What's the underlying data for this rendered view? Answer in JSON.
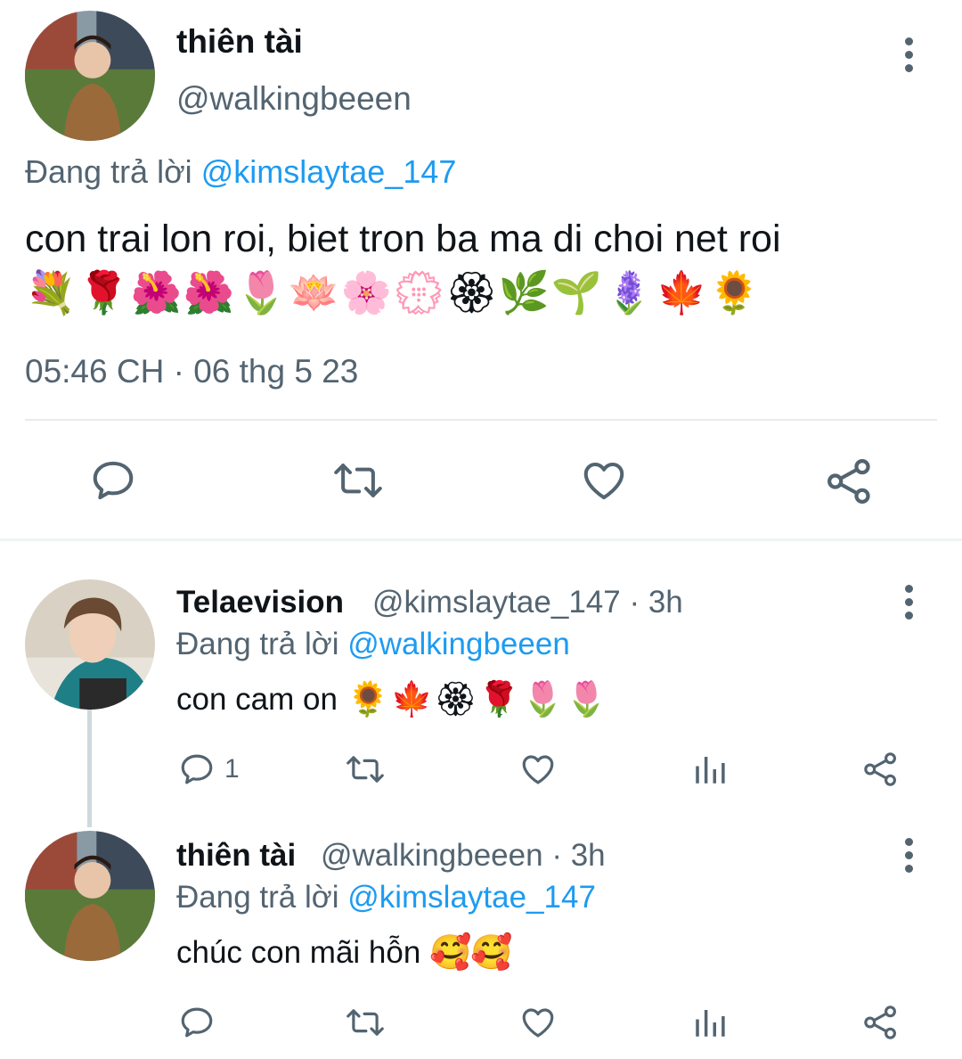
{
  "main_tweet": {
    "author_name": "thiên tài",
    "author_handle": "@walkingbeeen",
    "replying_prefix": "Đang trả lời",
    "replying_to": "@kimslaytae_147",
    "text": "con trai lon roi, biet tron ba ma di choi net roi",
    "emojis": [
      "💐",
      "🌹",
      "🌺",
      "🌺",
      "🌷",
      "🪷",
      "🌸",
      "💮",
      "🏵",
      "🌿",
      "🌱",
      "🪻",
      "🍁",
      "🌻"
    ],
    "timestamp": "05:46 CH · 06 thg 5 23",
    "actions": [
      "reply-icon",
      "retweet-icon",
      "like-icon",
      "share-icon"
    ]
  },
  "replies": [
    {
      "author_name": "Telaevision",
      "author_handle": "@kimslaytae_147",
      "time": "· 3h",
      "replying_prefix": "Đang trả lời",
      "replying_to": "@walkingbeeen",
      "text": "con cam on",
      "emojis": [
        "🌻",
        "🍁",
        "🏵",
        "🌹",
        "🌷",
        "🌷"
      ],
      "reply_count": "1",
      "actions": [
        "reply-icon",
        "retweet-icon",
        "like-icon",
        "views-icon",
        "share-icon"
      ]
    },
    {
      "author_name": "thiên tài",
      "author_handle": "@walkingbeeen",
      "time": "· 3h",
      "replying_prefix": "Đang trả lời",
      "replying_to": "@kimslaytae_147",
      "text": "chúc con mãi hỗn",
      "emojis": [
        "🥰",
        "🥰"
      ],
      "reply_count": "",
      "actions": [
        "reply-icon",
        "retweet-icon",
        "like-icon",
        "views-icon",
        "share-icon"
      ]
    }
  ],
  "colors": {
    "text_primary": "#0f1419",
    "text_secondary": "#536471",
    "link": "#1d9bf0",
    "divider": "#e6ecf0",
    "thread_line": "#cfd9de"
  }
}
